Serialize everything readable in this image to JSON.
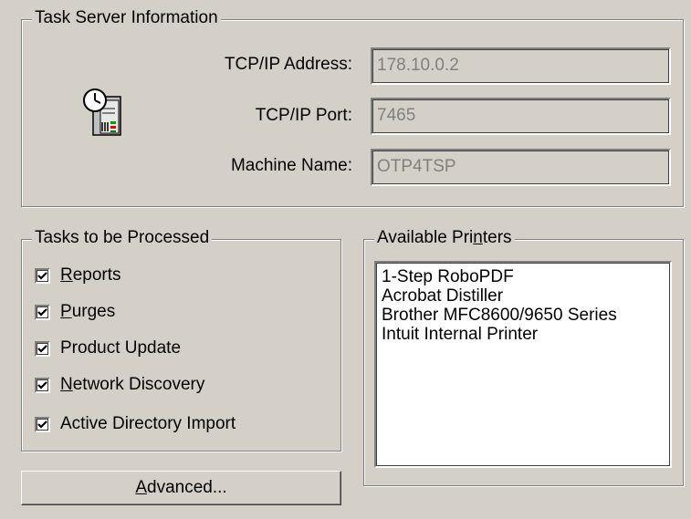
{
  "server_group": {
    "title": "Task Server Information",
    "icon": "server-clock-icon",
    "fields": [
      {
        "label": "TCP/IP Address:",
        "value": "178.10.0.2"
      },
      {
        "label": "TCP/IP Port:",
        "value": "7465"
      },
      {
        "label": "Machine Name:",
        "value": "OTP4TSP"
      }
    ]
  },
  "tasks_group": {
    "title": "Tasks to be Processed",
    "items": [
      {
        "access_key": "R",
        "rest": "eports",
        "checked": true
      },
      {
        "access_key": "P",
        "rest": "urges",
        "checked": true
      },
      {
        "access_key": "",
        "rest": "Product Update",
        "checked": true
      },
      {
        "access_key": "N",
        "rest": "etwork Discovery",
        "checked": true
      },
      {
        "access_key": "",
        "rest": "Active Directory Import",
        "checked": true
      }
    ]
  },
  "printers_group": {
    "title_before": "Available Pri",
    "title_key": "n",
    "title_after": "ters",
    "printers": [
      "1-Step RoboPDF",
      "Acrobat Distiller",
      "Brother MFC8600/9650 Series",
      "Intuit Internal Printer"
    ]
  },
  "advanced_button": {
    "access_key": "A",
    "rest": "dvanced..."
  },
  "colors": {
    "face": "#d4d0c8",
    "shadow": "#808080",
    "highlight": "#ffffff",
    "disabled_text": "#808080"
  }
}
